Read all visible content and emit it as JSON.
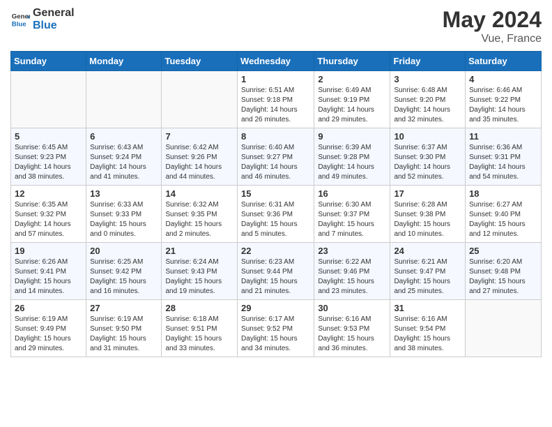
{
  "header": {
    "logo_general": "General",
    "logo_blue": "Blue",
    "month_title": "May 2024",
    "location": "Vue, France"
  },
  "weekdays": [
    "Sunday",
    "Monday",
    "Tuesday",
    "Wednesday",
    "Thursday",
    "Friday",
    "Saturday"
  ],
  "weeks": [
    [
      {
        "day": "",
        "info": ""
      },
      {
        "day": "",
        "info": ""
      },
      {
        "day": "",
        "info": ""
      },
      {
        "day": "1",
        "info": "Sunrise: 6:51 AM\nSunset: 9:18 PM\nDaylight: 14 hours\nand 26 minutes."
      },
      {
        "day": "2",
        "info": "Sunrise: 6:49 AM\nSunset: 9:19 PM\nDaylight: 14 hours\nand 29 minutes."
      },
      {
        "day": "3",
        "info": "Sunrise: 6:48 AM\nSunset: 9:20 PM\nDaylight: 14 hours\nand 32 minutes."
      },
      {
        "day": "4",
        "info": "Sunrise: 6:46 AM\nSunset: 9:22 PM\nDaylight: 14 hours\nand 35 minutes."
      }
    ],
    [
      {
        "day": "5",
        "info": "Sunrise: 6:45 AM\nSunset: 9:23 PM\nDaylight: 14 hours\nand 38 minutes."
      },
      {
        "day": "6",
        "info": "Sunrise: 6:43 AM\nSunset: 9:24 PM\nDaylight: 14 hours\nand 41 minutes."
      },
      {
        "day": "7",
        "info": "Sunrise: 6:42 AM\nSunset: 9:26 PM\nDaylight: 14 hours\nand 44 minutes."
      },
      {
        "day": "8",
        "info": "Sunrise: 6:40 AM\nSunset: 9:27 PM\nDaylight: 14 hours\nand 46 minutes."
      },
      {
        "day": "9",
        "info": "Sunrise: 6:39 AM\nSunset: 9:28 PM\nDaylight: 14 hours\nand 49 minutes."
      },
      {
        "day": "10",
        "info": "Sunrise: 6:37 AM\nSunset: 9:30 PM\nDaylight: 14 hours\nand 52 minutes."
      },
      {
        "day": "11",
        "info": "Sunrise: 6:36 AM\nSunset: 9:31 PM\nDaylight: 14 hours\nand 54 minutes."
      }
    ],
    [
      {
        "day": "12",
        "info": "Sunrise: 6:35 AM\nSunset: 9:32 PM\nDaylight: 14 hours\nand 57 minutes."
      },
      {
        "day": "13",
        "info": "Sunrise: 6:33 AM\nSunset: 9:33 PM\nDaylight: 15 hours\nand 0 minutes."
      },
      {
        "day": "14",
        "info": "Sunrise: 6:32 AM\nSunset: 9:35 PM\nDaylight: 15 hours\nand 2 minutes."
      },
      {
        "day": "15",
        "info": "Sunrise: 6:31 AM\nSunset: 9:36 PM\nDaylight: 15 hours\nand 5 minutes."
      },
      {
        "day": "16",
        "info": "Sunrise: 6:30 AM\nSunset: 9:37 PM\nDaylight: 15 hours\nand 7 minutes."
      },
      {
        "day": "17",
        "info": "Sunrise: 6:28 AM\nSunset: 9:38 PM\nDaylight: 15 hours\nand 10 minutes."
      },
      {
        "day": "18",
        "info": "Sunrise: 6:27 AM\nSunset: 9:40 PM\nDaylight: 15 hours\nand 12 minutes."
      }
    ],
    [
      {
        "day": "19",
        "info": "Sunrise: 6:26 AM\nSunset: 9:41 PM\nDaylight: 15 hours\nand 14 minutes."
      },
      {
        "day": "20",
        "info": "Sunrise: 6:25 AM\nSunset: 9:42 PM\nDaylight: 15 hours\nand 16 minutes."
      },
      {
        "day": "21",
        "info": "Sunrise: 6:24 AM\nSunset: 9:43 PM\nDaylight: 15 hours\nand 19 minutes."
      },
      {
        "day": "22",
        "info": "Sunrise: 6:23 AM\nSunset: 9:44 PM\nDaylight: 15 hours\nand 21 minutes."
      },
      {
        "day": "23",
        "info": "Sunrise: 6:22 AM\nSunset: 9:46 PM\nDaylight: 15 hours\nand 23 minutes."
      },
      {
        "day": "24",
        "info": "Sunrise: 6:21 AM\nSunset: 9:47 PM\nDaylight: 15 hours\nand 25 minutes."
      },
      {
        "day": "25",
        "info": "Sunrise: 6:20 AM\nSunset: 9:48 PM\nDaylight: 15 hours\nand 27 minutes."
      }
    ],
    [
      {
        "day": "26",
        "info": "Sunrise: 6:19 AM\nSunset: 9:49 PM\nDaylight: 15 hours\nand 29 minutes."
      },
      {
        "day": "27",
        "info": "Sunrise: 6:19 AM\nSunset: 9:50 PM\nDaylight: 15 hours\nand 31 minutes."
      },
      {
        "day": "28",
        "info": "Sunrise: 6:18 AM\nSunset: 9:51 PM\nDaylight: 15 hours\nand 33 minutes."
      },
      {
        "day": "29",
        "info": "Sunrise: 6:17 AM\nSunset: 9:52 PM\nDaylight: 15 hours\nand 34 minutes."
      },
      {
        "day": "30",
        "info": "Sunrise: 6:16 AM\nSunset: 9:53 PM\nDaylight: 15 hours\nand 36 minutes."
      },
      {
        "day": "31",
        "info": "Sunrise: 6:16 AM\nSunset: 9:54 PM\nDaylight: 15 hours\nand 38 minutes."
      },
      {
        "day": "",
        "info": ""
      }
    ]
  ]
}
